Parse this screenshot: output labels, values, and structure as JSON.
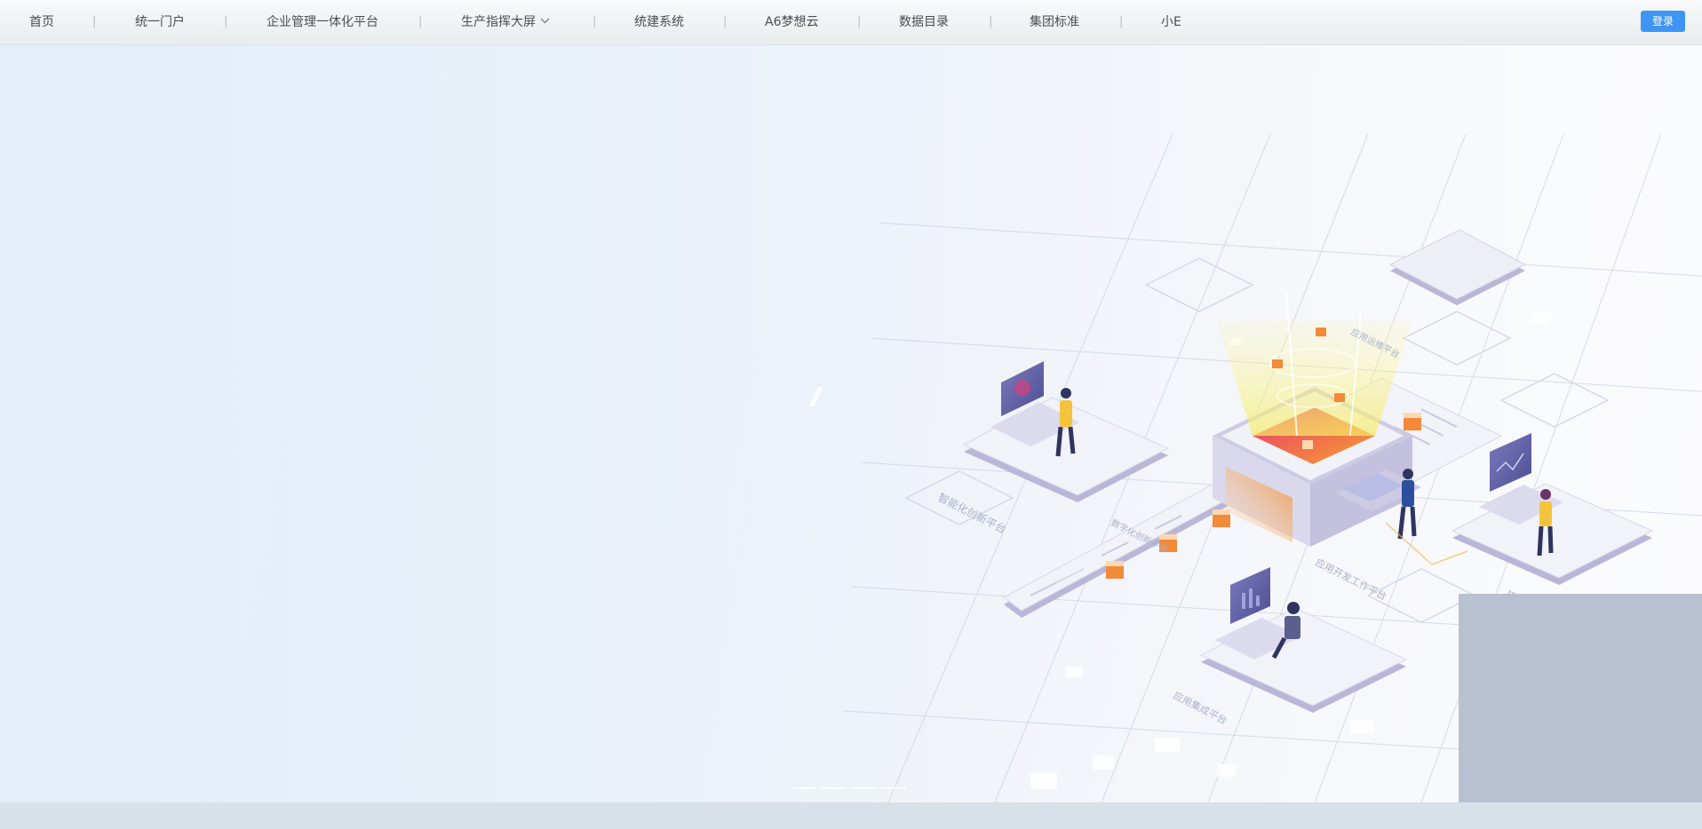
{
  "nav": {
    "items": [
      {
        "label": "首页"
      },
      {
        "label": "统一门户"
      },
      {
        "label": "企业管理一体化平台"
      },
      {
        "label": "生产指挥大屏",
        "has_dropdown": true
      },
      {
        "label": "统建系统"
      },
      {
        "label": "A6梦想云"
      },
      {
        "label": "数据目录"
      },
      {
        "label": "集团标准"
      },
      {
        "label": "小E"
      }
    ],
    "separator": "|",
    "login_label": "登录"
  },
  "colors": {
    "login_button": "#3e95f5",
    "nav_text": "#4a4d52",
    "hero_background": "#e3eef9"
  },
  "hero": {
    "labels": [
      "智能化创新平台",
      "应用运维平台",
      "应用开发工作平台",
      "应用集成平台",
      "技术运营平台",
      "数字化创新平台"
    ]
  },
  "carousel": {
    "slide_count": 4
  }
}
